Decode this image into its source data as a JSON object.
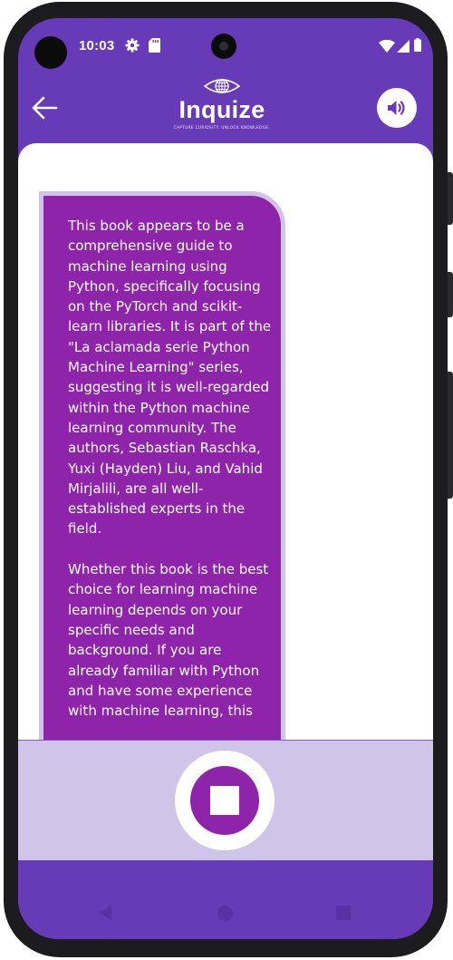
{
  "status_bar": {
    "time": "10:03",
    "icons": [
      "settings-gear-icon",
      "sd-card-icon",
      "wifi-icon",
      "cellular-signal-icon",
      "battery-icon"
    ]
  },
  "header": {
    "back_icon": "arrow-left-icon",
    "logo_text": "Inquize",
    "logo_tagline": "CAPTURE CURIOSITY. UNLOCK KNOWLEDGE.",
    "sound_icon": "volume-up-icon"
  },
  "message": {
    "text": "This book appears to be a comprehensive guide to machine learning using Python, specifically focusing on the PyTorch and scikit-learn libraries. It is part of the \"La aclamada serie Python Machine Learning\" series, suggesting it is well-regarded within the Python machine learning community. The authors, Sebastian Raschka, Yuxi (Hayden) Liu, and Vahid Mirjalili, are all well-established experts in the field.\n\nWhether this book is the best choice for learning machine learning depends on your specific needs and background. If you are already familiar with Python and have some experience with machine learning, this"
  },
  "controls": {
    "stop_icon": "stop-icon"
  },
  "nav": {
    "back_icon": "nav-back-triangle-icon",
    "home_icon": "nav-home-circle-icon",
    "recents_icon": "nav-recents-square-icon"
  },
  "colors": {
    "primary": "#673ab7",
    "bubble": "#8e24aa",
    "bubble_border": "#d1c4e9",
    "control_area": "#d1c4e9"
  }
}
